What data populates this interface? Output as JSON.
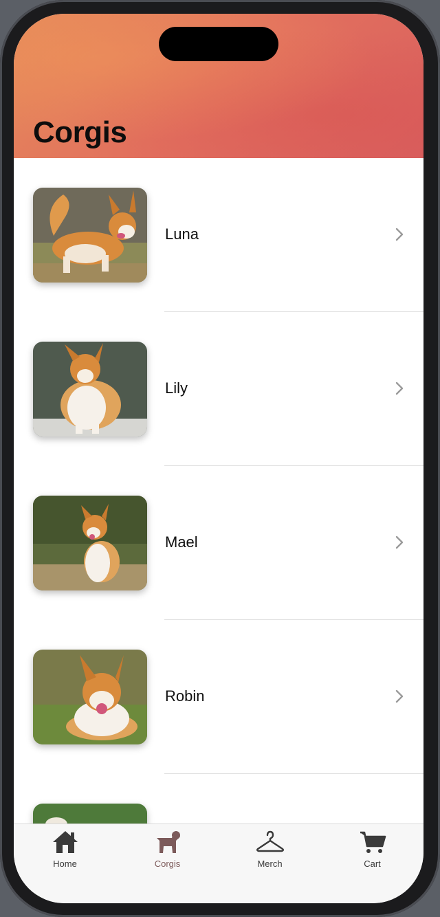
{
  "nav": {
    "title": "Corgis"
  },
  "list": {
    "items": [
      {
        "name": "Luna",
        "photo": "corgi-running"
      },
      {
        "name": "Lily",
        "photo": "corgi-standing"
      },
      {
        "name": "Mael",
        "photo": "corgi-sitting"
      },
      {
        "name": "Robin",
        "photo": "corgi-lying"
      },
      {
        "name": "",
        "photo": "corgi-partial"
      }
    ],
    "chevron_icon": "chevron-right-icon"
  },
  "tabbar": {
    "tabs": [
      {
        "label": "Home",
        "icon": "house-icon",
        "active": false
      },
      {
        "label": "Corgis",
        "icon": "dog-icon",
        "active": true
      },
      {
        "label": "Merch",
        "icon": "hanger-icon",
        "active": false
      },
      {
        "label": "Cart",
        "icon": "cart-icon",
        "active": false
      }
    ]
  },
  "colors": {
    "header_gradient_start": "#e58a5a",
    "header_gradient_end": "#d9605f",
    "active_tab": "#7c5a5a",
    "inactive_tab": "#3a3a3a"
  }
}
